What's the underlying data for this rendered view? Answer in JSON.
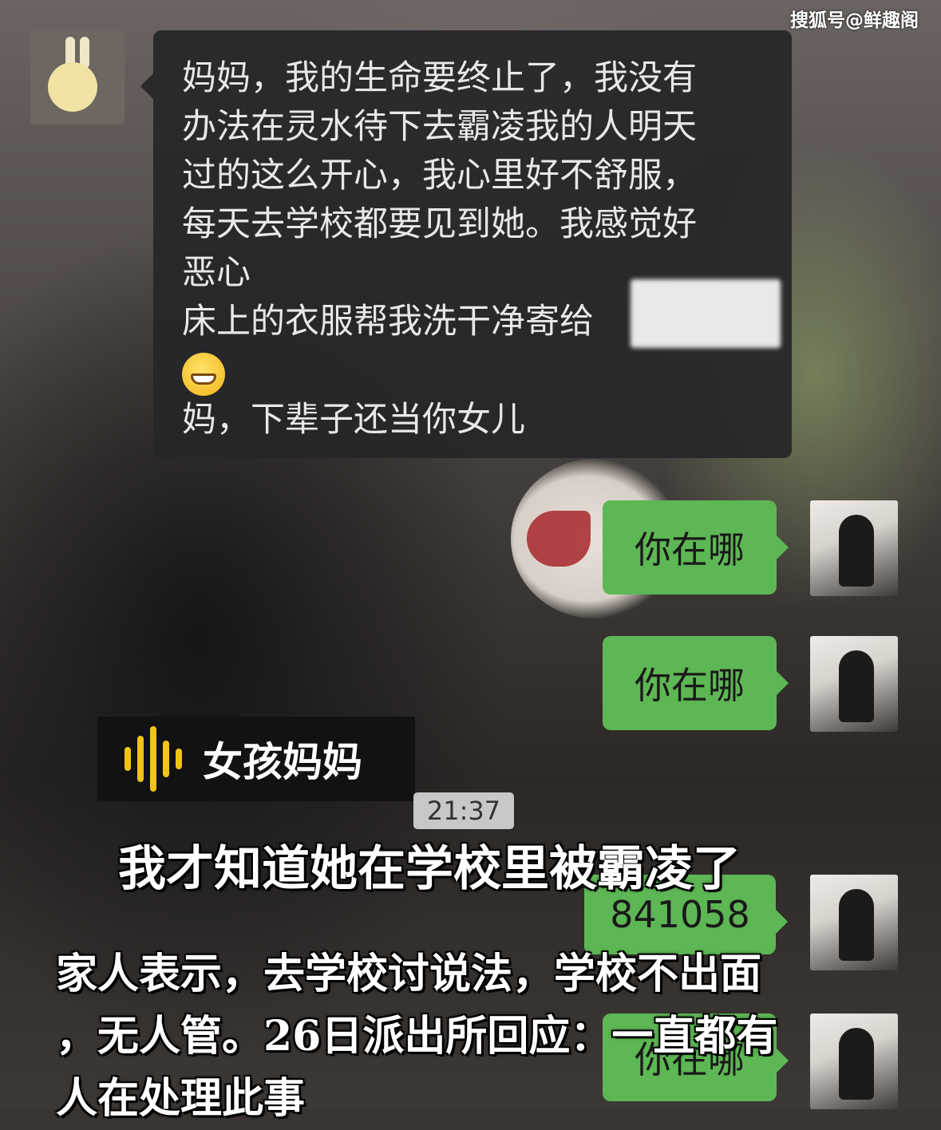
{
  "watermark": "搜狐号@鲜趣阁",
  "chat": {
    "incoming": {
      "lines": [
        "妈妈，我的生命要终止了，我没有",
        "办法在灵水待下去霸凌我的人明天",
        "过的这么开心，我心里好不舒服，",
        "每天去学校都要见到她。我感觉好",
        "恶心",
        "床上的衣服帮我洗干净寄给",
        "妈，下辈子还当你女儿"
      ],
      "emoji": "grinning-face-emoji"
    },
    "outgoing": [
      {
        "text": "你在哪"
      },
      {
        "text": "你在哪"
      },
      {
        "text": "841058"
      },
      {
        "text": "你在哪"
      }
    ],
    "timestamp": "21:37"
  },
  "overlay": {
    "speaker": "女孩妈妈",
    "headline": "我才知道她在学校里被霸凌了",
    "caption_lines": [
      "家人表示，去学校讨说法，学校不出面",
      "，无人管。26日派出所回应：一直都有",
      "人在处理此事"
    ]
  },
  "colors": {
    "outgoing_bubble": "#5db754",
    "incoming_bubble": "#262628",
    "speaker_wave": "#f2c318"
  }
}
